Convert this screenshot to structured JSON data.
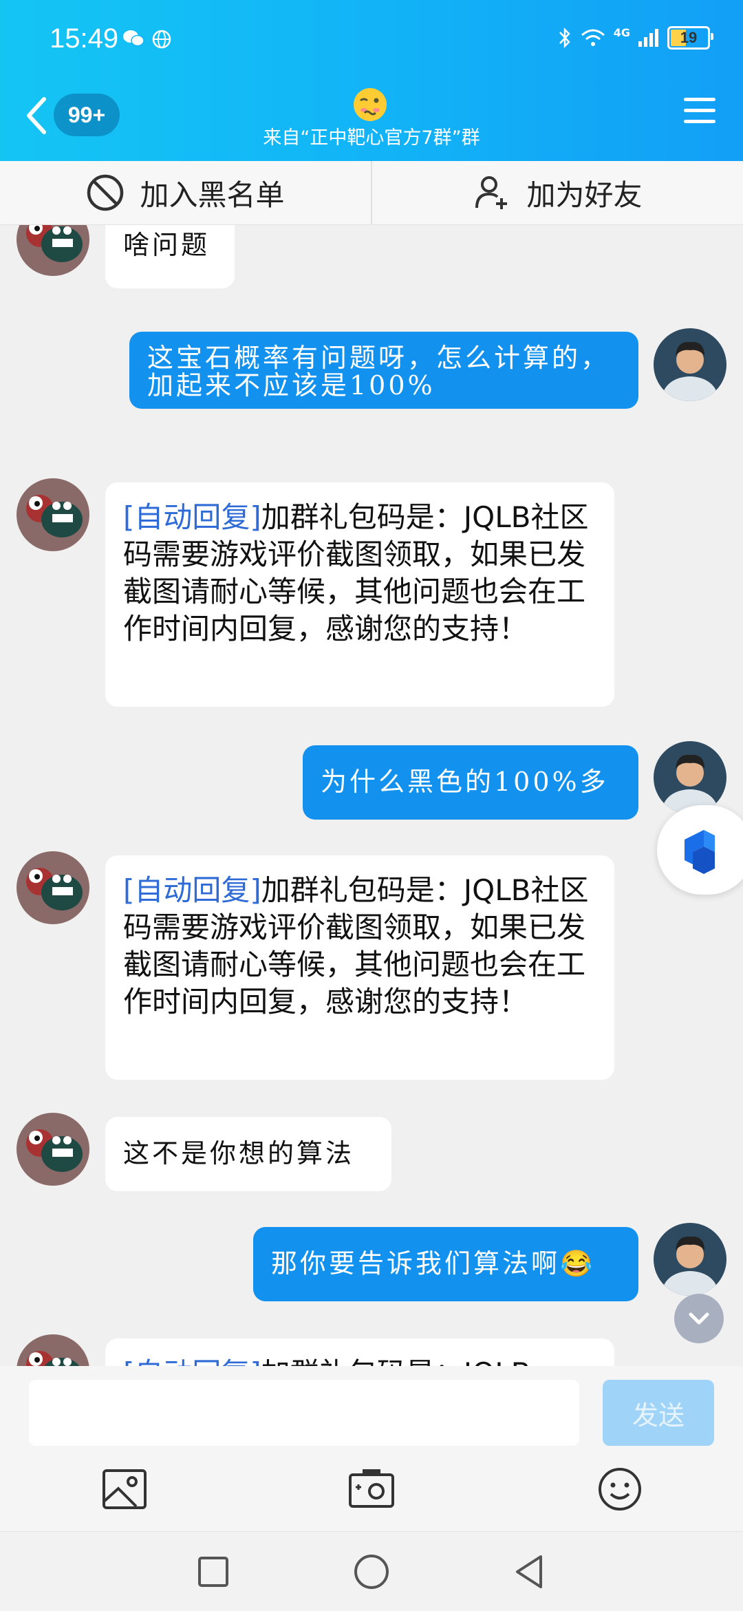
{
  "status_bar": {
    "time": "15:49",
    "network_label": "4G",
    "battery_level": "19"
  },
  "header": {
    "unread_badge": "99+",
    "title": "来自“正中靶心官方7群”群",
    "bg_start": "#14c5f4",
    "bg_end": "#129ff6"
  },
  "actions": {
    "blacklist_label": "加入黑名单",
    "add_friend_label": "加为好友"
  },
  "messages": [
    {
      "side": "in",
      "text": "啥问题"
    },
    {
      "side": "out",
      "text": "这宝石概率有问题呀，怎么计算的，加起来不应该是100%"
    },
    {
      "side": "in",
      "auto_tag": "[自动回复]",
      "text": "加群礼包码是：JQLB社区码需要游戏评价截图领取，如果已发截图请耐心等候，其他问题也会在工作时间内回复，感谢您的支持！"
    },
    {
      "side": "out",
      "text": "为什么黑色的100%多"
    },
    {
      "side": "in",
      "auto_tag": "[自动回复]",
      "text": "加群礼包码是：JQLB社区码需要游戏评价截图领取，如果已发截图请耐心等候，其他问题也会在工作时间内回复，感谢您的支持！"
    },
    {
      "side": "in",
      "text": "这不是你想的算法"
    },
    {
      "side": "out",
      "text": "那你要告诉我们算法啊😂"
    },
    {
      "side": "in",
      "auto_tag": "[自动回复]",
      "text": "加群礼包码是：JQLB"
    }
  ],
  "composer": {
    "placeholder": "",
    "send_label": "发送"
  },
  "colors": {
    "out_bubble": "#1292ee",
    "in_bubble": "#ffffff",
    "auto_tag": "#2f6bd6"
  },
  "icons": [
    "back-icon",
    "menu-icon",
    "block-icon",
    "add-user-icon",
    "image-icon",
    "camera-icon",
    "emoji-icon",
    "square-icon",
    "circle-icon",
    "triangle-back-icon"
  ]
}
